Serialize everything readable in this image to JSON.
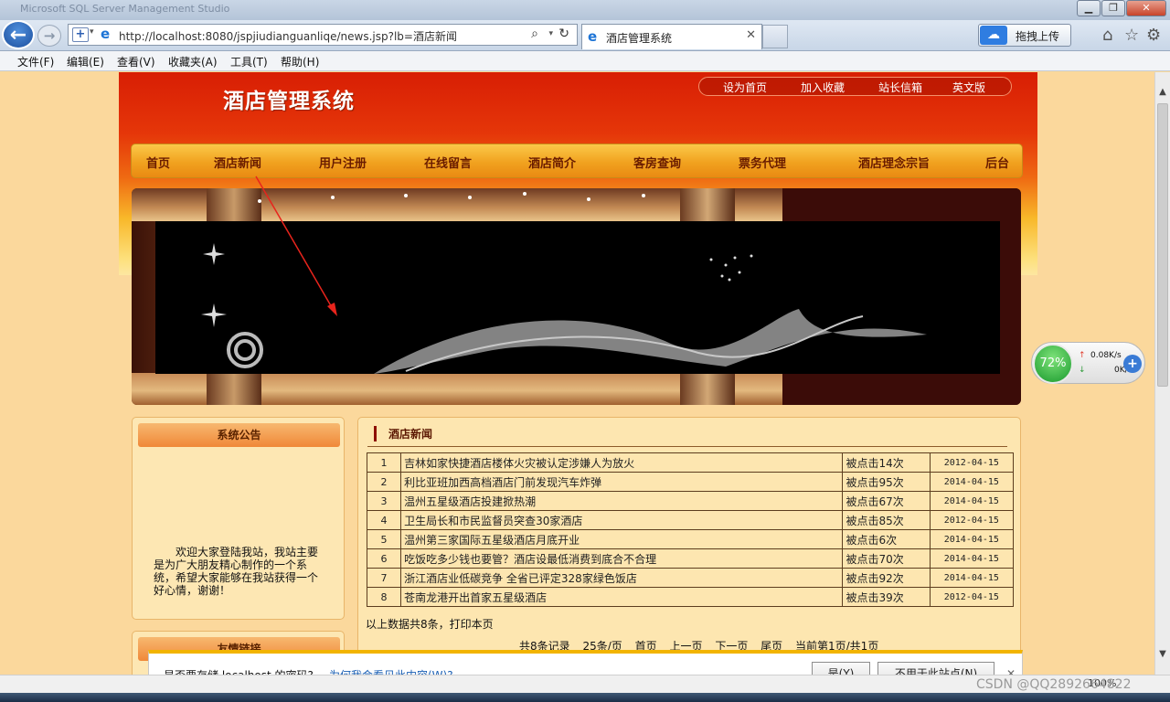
{
  "browser": {
    "window_title": "Microsoft SQL Server Management Studio",
    "url": "http://localhost:8080/jspjiudianguanliqe/news.jsp?lb=酒店新闻",
    "tab_title": "酒店管理系统",
    "upload_label": "拖拽上传",
    "menu": [
      "文件(F)",
      "编辑(E)",
      "查看(V)",
      "收藏夹(A)",
      "工具(T)",
      "帮助(H)"
    ],
    "zoom": "100%"
  },
  "site": {
    "logo": "酒店管理系统",
    "top_links": [
      "设为首页",
      "加入收藏",
      "站长信箱",
      "英文版"
    ],
    "nav": [
      "首页",
      "酒店新闻",
      "用户注册",
      "在线留言",
      "酒店简介",
      "客房查询",
      "票务代理",
      "酒店理念宗旨",
      "后台"
    ]
  },
  "notice": {
    "title": "系统公告",
    "text": "欢迎大家登陆我站，我站主要是为广大朋友精心制作的一个系统，希望大家能够在我站获得一个好心情，谢谢！"
  },
  "links_box": {
    "title": "友情链接"
  },
  "news": {
    "heading": "酒店新闻",
    "rows": [
      {
        "no": "1",
        "title": "吉林如家快捷酒店楼体火灾被认定涉嫌人为放火",
        "clicks": "被点击14次",
        "date": "2012-04-15"
      },
      {
        "no": "2",
        "title": "利比亚班加西高档酒店门前发现汽车炸弹",
        "clicks": "被点击95次",
        "date": "2014-04-15"
      },
      {
        "no": "3",
        "title": "温州五星级酒店投建掀热潮",
        "clicks": "被点击67次",
        "date": "2014-04-15"
      },
      {
        "no": "4",
        "title": "卫生局长和市民监督员突查30家酒店",
        "clicks": "被点击85次",
        "date": "2012-04-15"
      },
      {
        "no": "5",
        "title": "温州第三家国际五星级酒店月底开业",
        "clicks": "被点击6次",
        "date": "2014-04-15"
      },
      {
        "no": "6",
        "title": "吃饭吃多少钱也要管？酒店设最低消费到底合不合理",
        "clicks": "被点击70次",
        "date": "2014-04-15"
      },
      {
        "no": "7",
        "title": "浙江酒店业低碳竞争 全省已评定328家绿色饭店",
        "clicks": "被点击92次",
        "date": "2014-04-15"
      },
      {
        "no": "8",
        "title": "苍南龙港开出首家五星级酒店",
        "clicks": "被点击39次",
        "date": "2012-04-15"
      }
    ],
    "summary": "以上数据共8条，打印本页",
    "pager": [
      "共8条记录",
      "25条/页",
      "首页",
      "上一页",
      "下一页",
      "尾页",
      "当前第1页/共1页"
    ]
  },
  "speed_widget": {
    "percent": "72%",
    "up": "0.08K/s",
    "down": "0K/s"
  },
  "notification": {
    "message": "是否要存储 localhost 的密码?",
    "why_link": "为何我会看见此内容(W)?",
    "yes_button": "是(Y)",
    "no_button": "不用于此站点(N)"
  },
  "watermark": "CSDN @QQ2892664822",
  "colors": {
    "header_red": "#d81e04",
    "nav_gold": "#f1a21f",
    "page_bg": "#fbd89c",
    "arrow": "#e8241c"
  }
}
